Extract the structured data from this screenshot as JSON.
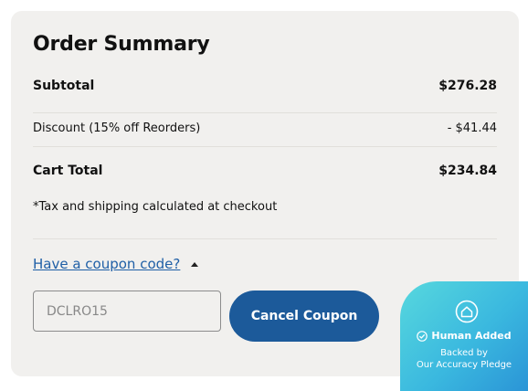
{
  "summary": {
    "title": "Order Summary",
    "subtotal_label": "Subtotal",
    "subtotal_value": "$276.28",
    "discount_label": "Discount (15% off Reorders)",
    "discount_value": "- $41.44",
    "total_label": "Cart Total",
    "total_value": "$234.84",
    "tax_note": "*Tax and shipping calculated at checkout"
  },
  "coupon": {
    "toggle_label": "Have a coupon code?",
    "code_value": "DCLRO15",
    "cancel_label": "Cancel Coupon"
  },
  "badge": {
    "title": "Human Added",
    "line1": "Backed by",
    "line2": "Our Accuracy Pledge"
  },
  "colors": {
    "card_bg": "#f1f0ee",
    "accent": "#1c5a9a",
    "link": "#1f5fa6",
    "badge_gradient_start": "#57d8de",
    "badge_gradient_end": "#2a93d6"
  },
  "icons": {
    "toggle": "caret-up-icon",
    "badge_emblem": "house-badge-icon",
    "badge_check": "check-circle-icon"
  }
}
